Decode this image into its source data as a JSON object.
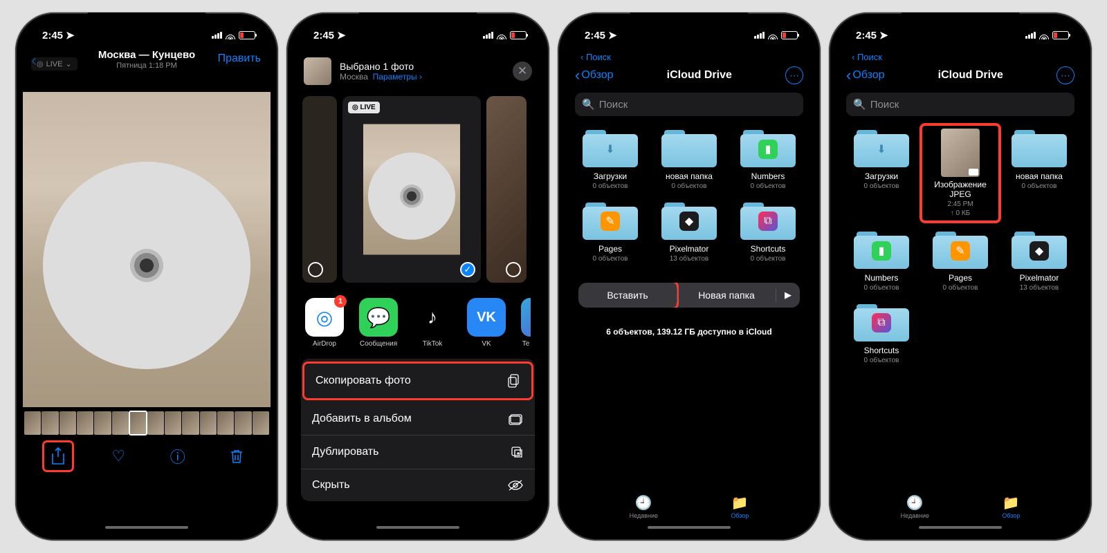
{
  "status": {
    "time": "2:45",
    "loc_arrow": "↗"
  },
  "p1": {
    "location": "Москва — Кунцево",
    "subtitle": "Пятница 1:18 PM",
    "edit": "Править",
    "live": "LIVE"
  },
  "p2": {
    "selected": "Выбрано 1 фото",
    "loc": "Москва",
    "params": "Параметры ›",
    "live_badge": "◎ LIVE",
    "apps": {
      "airdrop": "AirDrop",
      "messages": "Сообщения",
      "tiktok": "TikTok",
      "vk": "VK",
      "tg_cut": "Te",
      "badge": "1"
    },
    "actions": {
      "copy": "Скопировать фото",
      "album": "Добавить в альбом",
      "dup": "Дублировать",
      "hide": "Скрыть"
    }
  },
  "files": {
    "breadcrumb_search": "Поиск",
    "back": "Обзор",
    "title": "iCloud Drive",
    "search_ph": "Поиск",
    "items": {
      "downloads": {
        "name": "Загрузки",
        "meta": "0 объектов"
      },
      "newfolder": {
        "name": "новая папка",
        "meta": "0 объектов"
      },
      "numbers": {
        "name": "Numbers",
        "meta": "0 объектов"
      },
      "pages": {
        "name": "Pages",
        "meta": "0 объектов"
      },
      "pixelmator": {
        "name": "Pixelmator",
        "meta": "13 объектов"
      },
      "shortcuts": {
        "name": "Shortcuts",
        "meta": "0 объектов"
      },
      "jpeg": {
        "name": "Изображение JPEG",
        "meta1": "2:45 PM",
        "meta2": "↑ 0 КБ"
      }
    },
    "ctx": {
      "paste": "Вставить",
      "newf": "Новая папка",
      "arrow": "▶"
    },
    "storage": "6 объектов, 139.12 ГБ доступно в iCloud",
    "tabs": {
      "recent": "Недавние",
      "browse": "Обзор"
    }
  }
}
